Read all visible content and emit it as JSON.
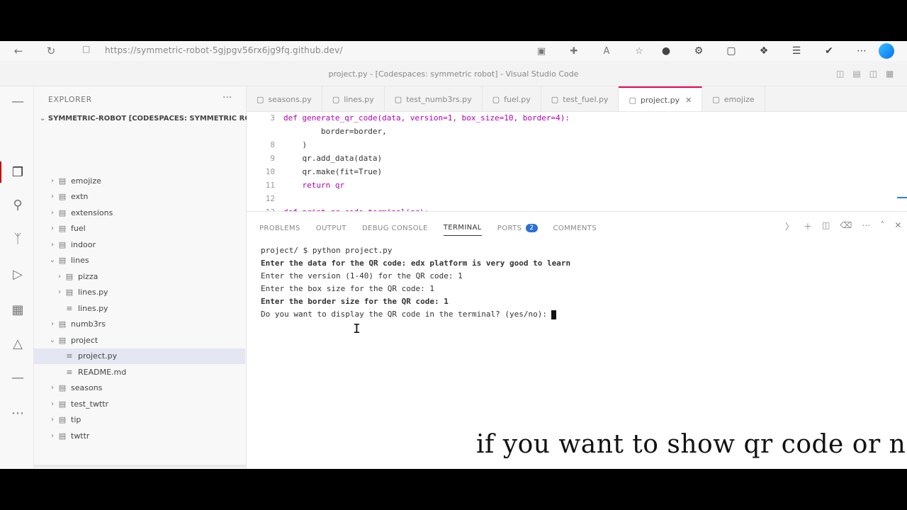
{
  "browser": {
    "url": "https://symmetric-robot-5gjpgv56rx6jg9fq.github.dev/",
    "back_icon": "back-arrow-icon",
    "reload_icon": "reload-icon",
    "lock_icon": "lock-icon"
  },
  "window": {
    "title": "project.py - [Codespaces: symmetric robot] - Visual Studio Code"
  },
  "sidebar": {
    "header": "EXPLORER",
    "menu": "···",
    "root": "SYMMETRIC-ROBOT [CODESPACES: SYMMETRIC ROBOT]",
    "items": [
      {
        "label": "emojize",
        "type": "folder",
        "open": false,
        "depth": 1
      },
      {
        "label": "extn",
        "type": "folder",
        "open": false,
        "depth": 1
      },
      {
        "label": "extensions",
        "type": "folder",
        "open": false,
        "depth": 1
      },
      {
        "label": "fuel",
        "type": "folder",
        "open": false,
        "depth": 1
      },
      {
        "label": "indoor",
        "type": "folder",
        "open": false,
        "depth": 1
      },
      {
        "label": "lines",
        "type": "folder",
        "open": true,
        "depth": 1
      },
      {
        "label": "pizza",
        "type": "folder",
        "open": false,
        "depth": 2
      },
      {
        "label": "lines.py",
        "type": "folder",
        "open": false,
        "depth": 2
      },
      {
        "label": "lines.py",
        "type": "file",
        "open": false,
        "depth": 2
      },
      {
        "label": "numb3rs",
        "type": "folder",
        "open": false,
        "depth": 1
      },
      {
        "label": "project",
        "type": "folder",
        "open": true,
        "depth": 1
      },
      {
        "label": "project.py",
        "type": "file",
        "open": false,
        "depth": 2,
        "selected": true
      },
      {
        "label": "README.md",
        "type": "file",
        "open": false,
        "depth": 2
      },
      {
        "label": "seasons",
        "type": "folder",
        "open": false,
        "depth": 1
      },
      {
        "label": "test_twttr",
        "type": "folder",
        "open": false,
        "depth": 1
      },
      {
        "label": "tip",
        "type": "folder",
        "open": false,
        "depth": 1
      },
      {
        "label": "twttr",
        "type": "folder",
        "open": false,
        "depth": 1
      }
    ]
  },
  "editor": {
    "tabs": [
      {
        "label": "seasons.py",
        "active": false
      },
      {
        "label": "lines.py",
        "active": false
      },
      {
        "label": "test_numb3rs.py",
        "active": false
      },
      {
        "label": "fuel.py",
        "active": false
      },
      {
        "label": "test_fuel.py",
        "active": false
      },
      {
        "label": "project.py",
        "active": true
      },
      {
        "label": "emojize",
        "active": false
      }
    ],
    "code": [
      {
        "n": "3",
        "text": "def generate_qr_code(data, version=1, box_size=10, border=4):"
      },
      {
        "n": "",
        "text": "        border=border,"
      },
      {
        "n": "8",
        "text": "    )"
      },
      {
        "n": "9",
        "text": "    qr.add_data(data)"
      },
      {
        "n": "10",
        "text": "    qr.make(fit=True)"
      },
      {
        "n": "11",
        "text": "    return qr"
      },
      {
        "n": "12",
        "text": ""
      },
      {
        "n": "13",
        "text": "def print_qr_code_terminal(qr):"
      }
    ]
  },
  "panel": {
    "tabs": [
      {
        "label": "PROBLEMS",
        "active": false
      },
      {
        "label": "OUTPUT",
        "active": false
      },
      {
        "label": "DEBUG CONSOLE",
        "active": false
      },
      {
        "label": "TERMINAL",
        "active": true
      },
      {
        "label": "PORTS",
        "active": false,
        "badge": "2"
      },
      {
        "label": "COMMENTS",
        "active": false
      }
    ],
    "terminal_lines": [
      {
        "text": "project/ $ python project.py",
        "bold": false
      },
      {
        "text": "Enter the data for the QR code: edx platform is very good to learn",
        "bold": true
      },
      {
        "text": "Enter the version (1-40) for the QR code: 1",
        "bold": false
      },
      {
        "text": "Enter the box size for the QR code: 1",
        "bold": false
      },
      {
        "text": "Enter the border size for the QR code: 1",
        "bold": true
      },
      {
        "text": "Do you want to display the QR code in the terminal? (yes/no):",
        "bold": false
      }
    ]
  },
  "caption": "if you want to show qr code or not"
}
